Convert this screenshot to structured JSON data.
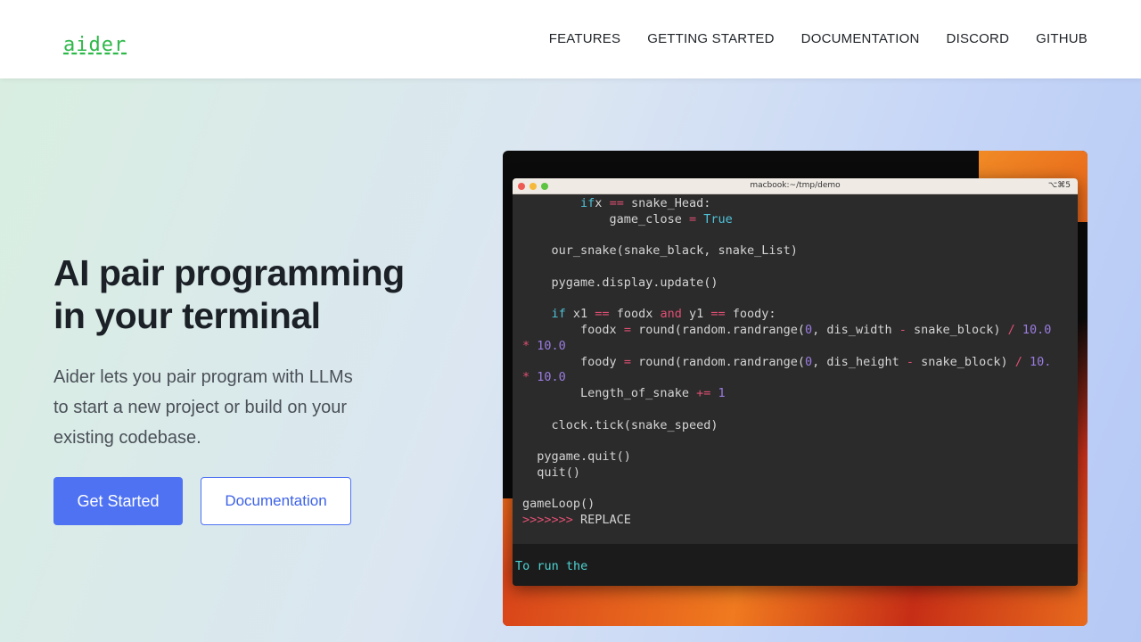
{
  "header": {
    "logo": "aider",
    "nav": [
      "FEATURES",
      "GETTING STARTED",
      "DOCUMENTATION",
      "DISCORD",
      "GITHUB"
    ]
  },
  "hero": {
    "title_line1": "AI pair programming",
    "title_line2": "in your terminal",
    "text_line1": "Aider lets you pair program with LLMs",
    "text_line2": "to start a new project or build on your",
    "text_line3": "existing codebase.",
    "primary_button": "Get Started",
    "secondary_button": "Documentation"
  },
  "terminal": {
    "title": "macbook:~/tmp/demo",
    "shortcut": "⌥⌘5",
    "run_text": "To run the",
    "code": [
      {
        "indent": "        ",
        "parts": [
          [
            "kw",
            "if"
          ],
          [
            "",
            "x "
          ],
          [
            "op",
            "=="
          ],
          [
            "",
            " snake_Head:"
          ]
        ]
      },
      {
        "indent": "            ",
        "parts": [
          [
            "",
            "game_close "
          ],
          [
            "op",
            "="
          ],
          [
            "",
            " "
          ],
          [
            "kw",
            "True"
          ]
        ]
      },
      {
        "indent": "",
        "parts": []
      },
      {
        "indent": "    ",
        "parts": [
          [
            "",
            "our_snake(snake_black, snake_List)"
          ]
        ]
      },
      {
        "indent": "",
        "parts": []
      },
      {
        "indent": "    ",
        "parts": [
          [
            "",
            "pygame.display.update()"
          ]
        ]
      },
      {
        "indent": "",
        "parts": []
      },
      {
        "indent": "    ",
        "parts": [
          [
            "kw",
            "if"
          ],
          [
            "",
            " x1 "
          ],
          [
            "op",
            "=="
          ],
          [
            "",
            " foodx "
          ],
          [
            "op",
            "and"
          ],
          [
            "",
            " y1 "
          ],
          [
            "op",
            "=="
          ],
          [
            "",
            " foody:"
          ]
        ]
      },
      {
        "indent": "        ",
        "parts": [
          [
            "",
            "foodx "
          ],
          [
            "op",
            "="
          ],
          [
            "",
            " round(random.randrange("
          ],
          [
            "num",
            "0"
          ],
          [
            "",
            ", dis_width "
          ],
          [
            "op",
            "-"
          ],
          [
            "",
            " snake_block) "
          ],
          [
            "op",
            "/"
          ],
          [
            "num",
            " 10.0"
          ]
        ]
      },
      {
        "indent": "",
        "parts": [
          [
            "op",
            "*"
          ],
          [
            "num",
            " 10.0"
          ]
        ]
      },
      {
        "indent": "        ",
        "parts": [
          [
            "",
            "foody "
          ],
          [
            "op",
            "="
          ],
          [
            "",
            " round(random.randrange("
          ],
          [
            "num",
            "0"
          ],
          [
            "",
            ", dis_height "
          ],
          [
            "op",
            "-"
          ],
          [
            "",
            " snake_block) "
          ],
          [
            "op",
            "/"
          ],
          [
            "num",
            " 10."
          ]
        ]
      },
      {
        "indent": "",
        "parts": [
          [
            "op",
            "*"
          ],
          [
            "num",
            " 10.0"
          ]
        ]
      },
      {
        "indent": "        ",
        "parts": [
          [
            "",
            "Length_of_snake "
          ],
          [
            "op",
            "+="
          ],
          [
            "num",
            " 1"
          ]
        ]
      },
      {
        "indent": "",
        "parts": []
      },
      {
        "indent": "    ",
        "parts": [
          [
            "",
            "clock.tick(snake_speed)"
          ]
        ]
      },
      {
        "indent": "",
        "parts": []
      },
      {
        "indent": "  ",
        "parts": [
          [
            "",
            "pygame.quit()"
          ]
        ]
      },
      {
        "indent": "  ",
        "parts": [
          [
            "",
            "quit()"
          ]
        ]
      },
      {
        "indent": "",
        "parts": []
      },
      {
        "indent": "",
        "parts": [
          [
            "",
            "gameLoop()"
          ]
        ]
      },
      {
        "indent": "",
        "parts": [
          [
            "op",
            ">>>>>>>"
          ],
          [
            "",
            " REPLACE"
          ]
        ]
      }
    ]
  }
}
